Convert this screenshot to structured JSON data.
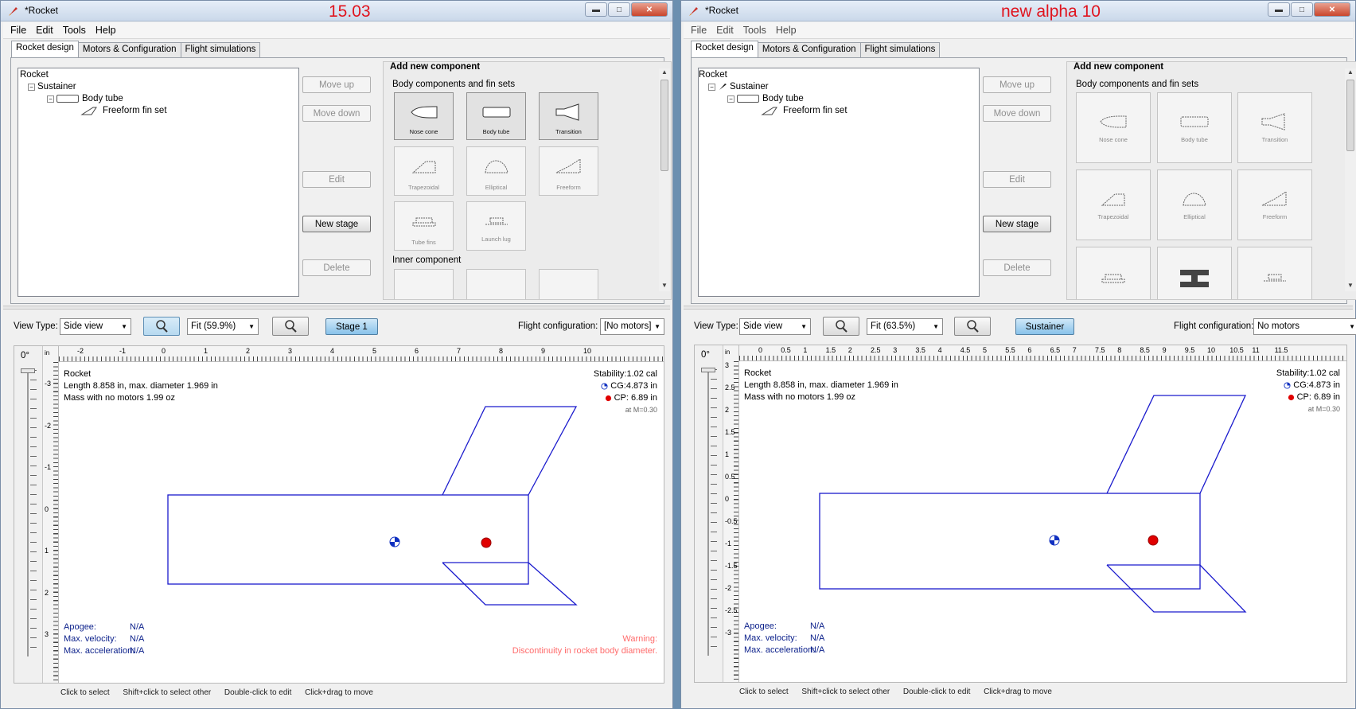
{
  "windows": [
    {
      "id": "left",
      "title": "*Rocket",
      "version_label": "15.03",
      "menu": [
        "File",
        "Edit",
        "Tools",
        "Help"
      ],
      "tabs": [
        "Rocket design",
        "Motors & Configuration",
        "Flight simulations"
      ],
      "tree": {
        "root": "Rocket",
        "stage": "Sustainer",
        "body": "Body tube",
        "fin": "Freeform fin set"
      },
      "buttons": {
        "move_up": "Move up",
        "move_down": "Move down",
        "edit": "Edit",
        "new_stage": "New stage",
        "delete": "Delete"
      },
      "add_panel": {
        "heading": "Add new component",
        "body_section": "Body components and fin sets",
        "inner_section": "Inner component",
        "components": [
          "Nose cone",
          "Body tube",
          "Transition",
          "Trapezoidal",
          "Elliptical",
          "Freeform",
          "Tube fins",
          "Launch lug"
        ]
      },
      "view_type_label": "View Type:",
      "view_type_value": "Side view",
      "zoom_value": "Fit (59.9%)",
      "stage_button": "Stage 1",
      "flight_config_label": "Flight configuration:",
      "flight_config_value": "[No motors]",
      "angle": "0°",
      "ruler_unit": "in",
      "h_ticks": [
        "-2",
        "-1",
        "0",
        "1",
        "2",
        "3",
        "4",
        "5",
        "6",
        "7",
        "8",
        "9",
        "10"
      ],
      "v_ticks": [
        "-3",
        "-2",
        "-1",
        "0",
        "1",
        "2",
        "3"
      ],
      "info": {
        "name": "Rocket",
        "length": "Length 8.858 in, max. diameter 1.969 in",
        "mass": "Mass with no motors 1.99 oz",
        "stability": "Stability:1.02 cal",
        "cg": "CG:4.873 in",
        "cp": "CP:  6.89 in",
        "mach": "at M=0.30"
      },
      "results": {
        "apogee_label": "Apogee:",
        "apogee": "N/A",
        "velocity_label": "Max. velocity:",
        "velocity": "N/A",
        "accel_label": "Max. acceleration:",
        "accel": "N/A"
      },
      "warning": {
        "title": "Warning:",
        "text": "Discontinuity in rocket body diameter."
      },
      "status": [
        "Click to select",
        "Shift+click to select other",
        "Double-click to edit",
        "Click+drag to move"
      ]
    },
    {
      "id": "right",
      "title": "*Rocket",
      "version_label": "new alpha 10",
      "menu": [
        "File",
        "Edit",
        "Tools",
        "Help"
      ],
      "tabs": [
        "Rocket design",
        "Motors & Configuration",
        "Flight simulations"
      ],
      "tree": {
        "root": "Rocket",
        "stage": "Sustainer",
        "body": "Body tube",
        "fin": "Freeform fin set"
      },
      "buttons": {
        "move_up": "Move up",
        "move_down": "Move down",
        "edit": "Edit",
        "new_stage": "New stage",
        "delete": "Delete"
      },
      "add_panel": {
        "heading": "Add new component",
        "body_section": "Body components and fin sets",
        "components": [
          "Nose cone",
          "Body tube",
          "Transition",
          "Trapezoidal",
          "Elliptical",
          "Freeform"
        ]
      },
      "view_type_label": "View Type:",
      "view_type_value": "Side view",
      "zoom_value": "Fit (63.5%)",
      "stage_button": "Sustainer",
      "flight_config_label": "Flight configuration:",
      "flight_config_value": "No motors",
      "angle": "0°",
      "ruler_unit": "in",
      "h_ticks": [
        "0",
        "0.5",
        "1",
        "1.5",
        "2",
        "2.5",
        "3",
        "3.5",
        "4",
        "4.5",
        "5",
        "5.5",
        "6",
        "6.5",
        "7",
        "7.5",
        "8",
        "8.5",
        "9",
        "9.5",
        "10",
        "10.5",
        "11",
        "11.5"
      ],
      "v_ticks": [
        "3",
        "2.5",
        "2",
        "1.5",
        "1",
        "0.5",
        "0",
        "-0.5",
        "-1",
        "-1.5",
        "-2",
        "-2.5",
        "-3"
      ],
      "info": {
        "name": "Rocket",
        "length": "Length 8.858 in, max. diameter 1.969 in",
        "mass": "Mass with no motors 1.99 oz",
        "stability": "Stability:1.02 cal",
        "cg": "CG:4.873 in",
        "cp": "CP:  6.89 in",
        "mach": "at M=0.30"
      },
      "results": {
        "apogee_label": "Apogee:",
        "apogee": "N/A",
        "velocity_label": "Max. velocity:",
        "velocity": "N/A",
        "accel_label": "Max. acceleration:",
        "accel": "N/A"
      },
      "status": [
        "Click to select",
        "Shift+click to select other",
        "Double-click to edit",
        "Click+drag to move"
      ]
    }
  ],
  "colors": {
    "outline": "#1a1acd",
    "cp": "#e00000",
    "cg": "#1030c0",
    "warning": "#ff6b6b",
    "version_label": "#e0141e"
  }
}
